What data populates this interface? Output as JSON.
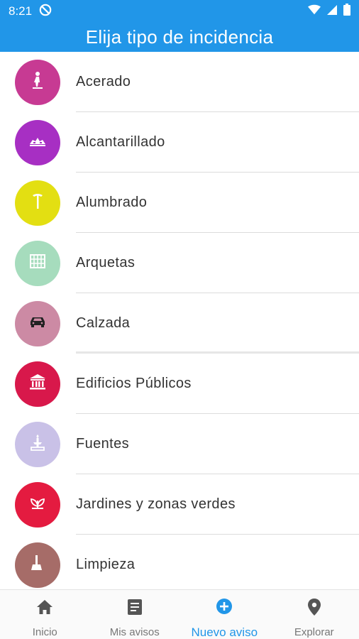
{
  "status": {
    "time": "8:21"
  },
  "header": {
    "title": "Elija tipo de incidencia"
  },
  "items": [
    {
      "label": "Acerado",
      "color": "#c73a93",
      "icon": "pedestrian-icon"
    },
    {
      "label": "Alcantarillado",
      "color": "#a72fc3",
      "icon": "sewer-icon"
    },
    {
      "label": "Alumbrado",
      "color": "#e3df12",
      "icon": "streetlight-icon"
    },
    {
      "label": "Arquetas",
      "color": "#a6dcbd",
      "icon": "manhole-grid-icon"
    },
    {
      "label": "Calzada",
      "color": "#cc8aa4",
      "icon": "car-icon"
    },
    {
      "label": "Edificios Públicos",
      "color": "#d8184b",
      "icon": "public-building-icon"
    },
    {
      "label": "Fuentes",
      "color": "#c9c1e7",
      "icon": "fountain-icon"
    },
    {
      "label": "Jardines y zonas verdes",
      "color": "#e41b40",
      "icon": "plant-icon"
    },
    {
      "label": "Limpieza",
      "color": "#a66c68",
      "icon": "broom-icon"
    }
  ],
  "bottom_nav": [
    {
      "label": "Inicio",
      "icon": "home-icon"
    },
    {
      "label": "Mis avisos",
      "icon": "document-icon"
    },
    {
      "label": "Nuevo aviso",
      "icon": "add-circle-icon",
      "active": true
    },
    {
      "label": "Explorar",
      "icon": "location-pin-icon"
    }
  ]
}
